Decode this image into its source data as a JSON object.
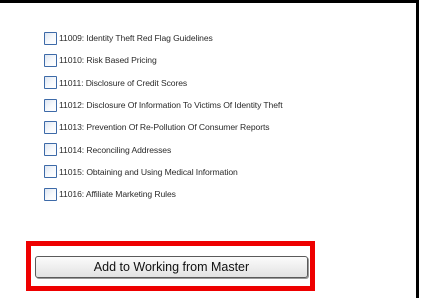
{
  "checklist": {
    "items": [
      {
        "label": "11009: Identity Theft Red Flag Guidelines"
      },
      {
        "label": "11010: Risk Based Pricing"
      },
      {
        "label": "11011: Disclosure of Credit Scores"
      },
      {
        "label": "11012: Disclosure Of Information To Victims Of Identity Theft"
      },
      {
        "label": "11013: Prevention Of Re-Pollution Of Consumer Reports"
      },
      {
        "label": "11014: Reconciling Addresses"
      },
      {
        "label": "11015: Obtaining and Using Medical Information"
      },
      {
        "label": "11016: Affiliate Marketing Rules"
      }
    ]
  },
  "action": {
    "add_button_label": "Add to Working from Master"
  },
  "colors": {
    "highlight": "#ee0000",
    "frame": "#000000",
    "checkbox_border": "#3d6aa8"
  }
}
